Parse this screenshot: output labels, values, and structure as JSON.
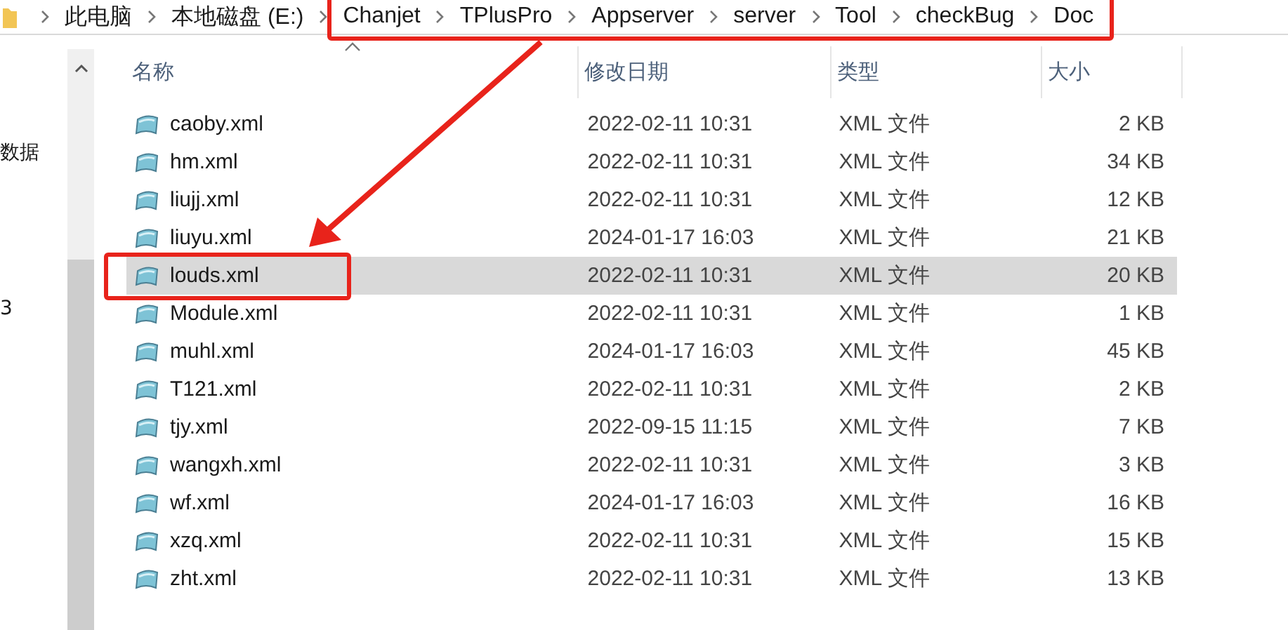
{
  "address_bar": {
    "breadcrumbs": [
      "此电脑",
      "本地磁盘 (E:)",
      "Chanjet",
      "TPlusPro",
      "Appserver",
      "server",
      "Tool",
      "checkBug",
      "Doc"
    ]
  },
  "nav_pane": {
    "items": [
      "数据",
      "3"
    ]
  },
  "file_list": {
    "columns": [
      {
        "label": "名称",
        "sorted": true
      },
      {
        "label": "修改日期",
        "sorted": false
      },
      {
        "label": "类型",
        "sorted": false
      },
      {
        "label": "大小",
        "sorted": false
      }
    ],
    "rows": [
      {
        "name": "caoby.xml",
        "modified": "2022-02-11 10:31",
        "type": "XML 文件",
        "size": "2 KB",
        "selected": false
      },
      {
        "name": "hm.xml",
        "modified": "2022-02-11 10:31",
        "type": "XML 文件",
        "size": "34 KB",
        "selected": false
      },
      {
        "name": "liujj.xml",
        "modified": "2022-02-11 10:31",
        "type": "XML 文件",
        "size": "12 KB",
        "selected": false
      },
      {
        "name": "liuyu.xml",
        "modified": "2024-01-17 16:03",
        "type": "XML 文件",
        "size": "21 KB",
        "selected": false
      },
      {
        "name": "louds.xml",
        "modified": "2022-02-11 10:31",
        "type": "XML 文件",
        "size": "20 KB",
        "selected": true
      },
      {
        "name": "Module.xml",
        "modified": "2022-02-11 10:31",
        "type": "XML 文件",
        "size": "1 KB",
        "selected": false
      },
      {
        "name": "muhl.xml",
        "modified": "2024-01-17 16:03",
        "type": "XML 文件",
        "size": "45 KB",
        "selected": false
      },
      {
        "name": "T121.xml",
        "modified": "2022-02-11 10:31",
        "type": "XML 文件",
        "size": "2 KB",
        "selected": false
      },
      {
        "name": "tjy.xml",
        "modified": "2022-09-15 11:15",
        "type": "XML 文件",
        "size": "7 KB",
        "selected": false
      },
      {
        "name": "wangxh.xml",
        "modified": "2022-02-11 10:31",
        "type": "XML 文件",
        "size": "3 KB",
        "selected": false
      },
      {
        "name": "wf.xml",
        "modified": "2024-01-17 16:03",
        "type": "XML 文件",
        "size": "16 KB",
        "selected": false
      },
      {
        "name": "xzq.xml",
        "modified": "2022-02-11 10:31",
        "type": "XML 文件",
        "size": "15 KB",
        "selected": false
      },
      {
        "name": "zht.xml",
        "modified": "2022-02-11 10:31",
        "type": "XML 文件",
        "size": "13 KB",
        "selected": false
      }
    ]
  }
}
